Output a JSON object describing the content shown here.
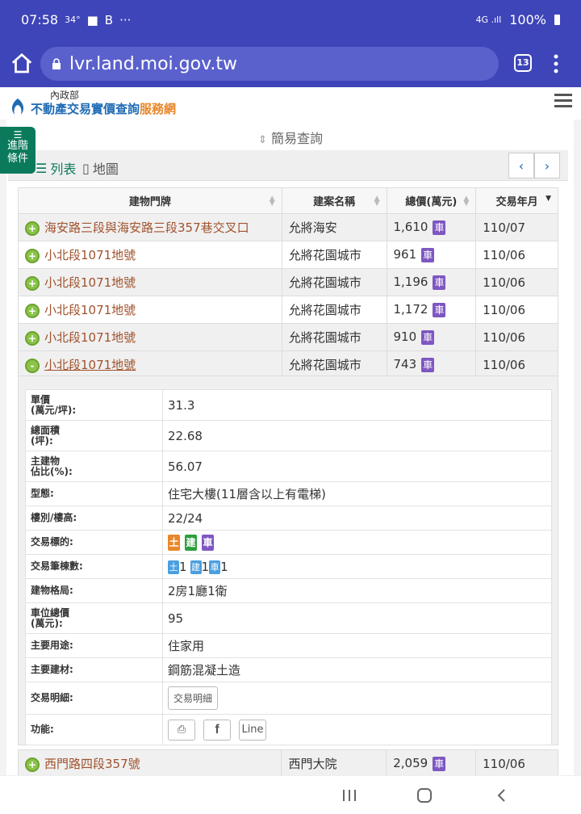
{
  "status_bar": {
    "time": "07:58",
    "temp": "34°",
    "battery": "100%"
  },
  "browser": {
    "url": "lvr.land.moi.gov.tw",
    "tab_count": "13"
  },
  "site": {
    "ministry": "內政部",
    "name_main": "不動產交易實價查詢",
    "name_accent": "服務網"
  },
  "advanced_filter_label": [
    "進階",
    "條件"
  ],
  "simple_query_label": "簡易查詢",
  "view_tabs": {
    "list": "列表",
    "map": "地圖"
  },
  "columns": [
    "建物門牌",
    "建案名稱",
    "總價(萬元)",
    "交易年月"
  ],
  "rows": [
    {
      "address": "海安路三段與海安路三段357巷交叉口",
      "project": "允將海安",
      "price": "1,610",
      "date": "110/07"
    },
    {
      "address": "小北段1071地號",
      "project": "允將花園城市",
      "price": "961",
      "date": "110/06"
    },
    {
      "address": "小北段1071地號",
      "project": "允將花園城市",
      "price": "1,196",
      "date": "110/06"
    },
    {
      "address": "小北段1071地號",
      "project": "允將花園城市",
      "price": "1,172",
      "date": "110/06"
    },
    {
      "address": "小北段1071地號",
      "project": "允將花園城市",
      "price": "910",
      "date": "110/06"
    },
    {
      "address": "小北段1071地號",
      "project": "允將花園城市",
      "price": "743",
      "date": "110/06"
    }
  ],
  "car_tag": "車",
  "expand_plus": "+",
  "expand_minus": "-",
  "detail": {
    "unit_price_label": [
      "單價",
      "(萬元/坪):"
    ],
    "unit_price": "31.3",
    "area_label": [
      "總面積",
      "(坪):"
    ],
    "area": "22.68",
    "main_ratio_label": [
      "主建物",
      "佔比(%):"
    ],
    "main_ratio": "56.07",
    "type_label": "型態:",
    "type": "住宅大樓(11層含以上有電梯)",
    "floor_label": "樓別/樓高:",
    "floor": "22/24",
    "target_label": "交易標的:",
    "target_tags": [
      "土",
      "建",
      "車"
    ],
    "count_label": "交易筆棟數:",
    "counts": [
      {
        "tag": "土",
        "n": "1"
      },
      {
        "tag": "建",
        "n": "1"
      },
      {
        "tag": "車",
        "n": "1"
      }
    ],
    "layout_label": "建物格局:",
    "layout": "2房1廳1衛",
    "parking_label": [
      "車位總價",
      "(萬元):"
    ],
    "parking": "95",
    "use_label": "主要用途:",
    "use": "住家用",
    "material_label": "主要建材:",
    "material": "鋼筋混凝土造",
    "detail_label": "交易明細:",
    "detail_button": "交易明細",
    "func_label": "功能:",
    "line_button": "Line"
  },
  "last_row": {
    "address": "西門路四段357號",
    "project": "西門大院",
    "price": "2,059",
    "date": "110/06"
  }
}
